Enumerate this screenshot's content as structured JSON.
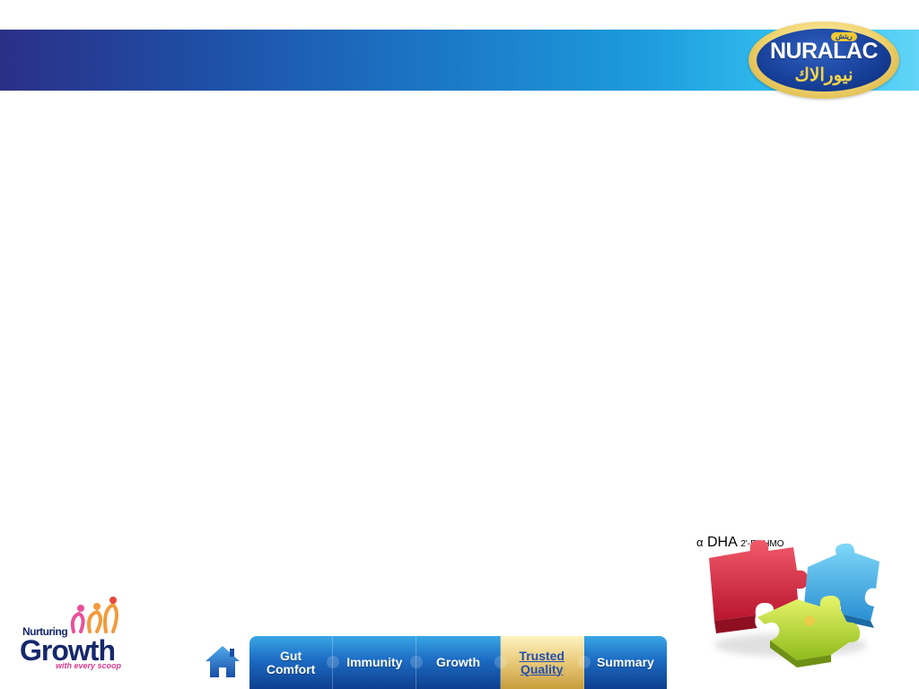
{
  "header": {
    "brand_latin": "NURALAC",
    "brand_arabic": "نيورالاك",
    "brand_tag": "ريتش"
  },
  "growth_logo": {
    "line1": "Nurturing",
    "line2": "Growth",
    "line3": "with every scoop"
  },
  "puzzle": {
    "pieces": [
      "α",
      "DHA",
      "2'-FL HMO"
    ]
  },
  "nav": {
    "home_icon": "home-icon",
    "tabs": [
      {
        "label": "Gut\nComfort",
        "active": false
      },
      {
        "label": "Immunity",
        "active": false
      },
      {
        "label": "Growth",
        "active": false
      },
      {
        "label": "Trusted\nQuality",
        "active": true
      },
      {
        "label": "Summary",
        "active": false
      }
    ]
  },
  "colors": {
    "header_start": "#2b2f86",
    "header_end": "#62d4f7",
    "nav_blue": "#1c6cc3",
    "nav_active_gold": "#e5c572",
    "brand_navy": "#17286c"
  }
}
